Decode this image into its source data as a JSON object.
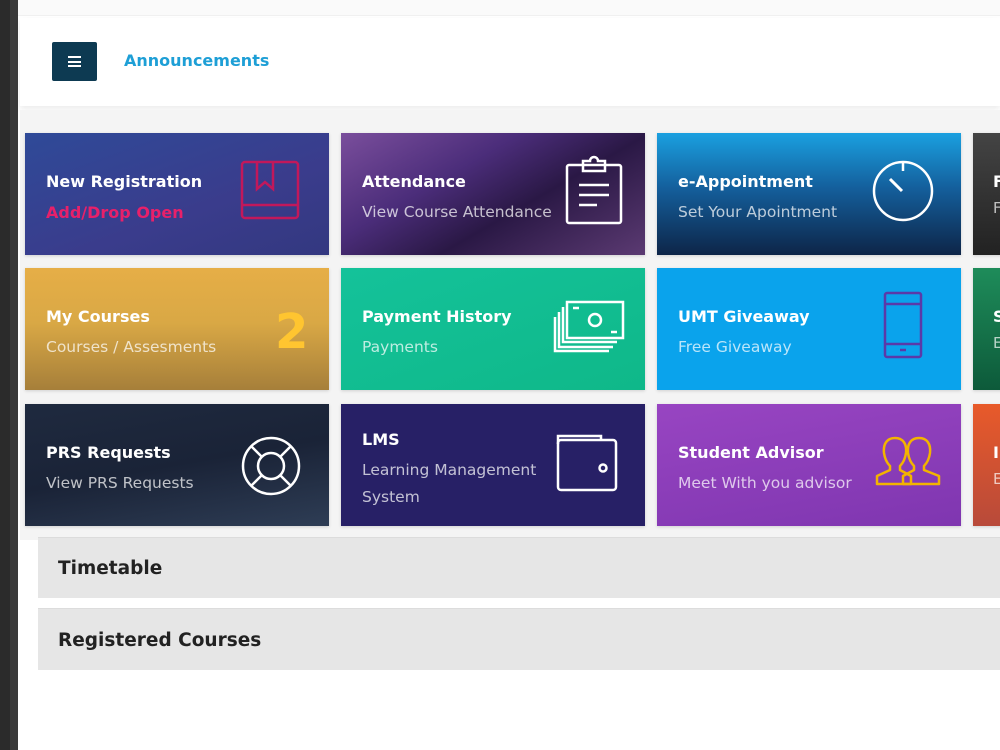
{
  "header": {
    "title": "Announcements",
    "menu_icon": "hamburger-menu-icon"
  },
  "cards": [
    {
      "title": "New Registration",
      "sub": "Add/Drop Open",
      "icon": "book-icon"
    },
    {
      "title": "Attendance",
      "sub": "View Course Attendance",
      "icon": "clipboard-icon"
    },
    {
      "title": "e-Appointment",
      "sub": "Set Your Apointment",
      "icon": "timer-icon"
    },
    {
      "title": "F",
      "sub": "F"
    },
    {
      "title": "My Courses",
      "sub": "Courses / Assesments",
      "count": "2"
    },
    {
      "title": "Payment History",
      "sub": "Payments",
      "icon": "money-icon"
    },
    {
      "title": "UMT Giveaway",
      "sub": "Free Giveaway",
      "icon": "mobile-phone-icon"
    },
    {
      "title": "S",
      "sub": "E"
    },
    {
      "title": "PRS Requests",
      "sub": "View PRS Requests",
      "icon": "lifebuoy-icon"
    },
    {
      "title": "LMS",
      "sub": "Learning Management",
      "sub2": "System",
      "icon": "wallet-icon"
    },
    {
      "title": "Student Advisor",
      "sub": "Meet With you advisor",
      "icon": "users-icon"
    },
    {
      "title": "I",
      "sub": "E"
    }
  ],
  "panels": [
    {
      "title": "Timetable"
    },
    {
      "title": "Registered Courses"
    }
  ],
  "colors": {
    "accent": "#1e9fd6",
    "menu_button": "#0d3a52",
    "registration_alert": "#e8206a",
    "course_count": "#ffc530"
  }
}
